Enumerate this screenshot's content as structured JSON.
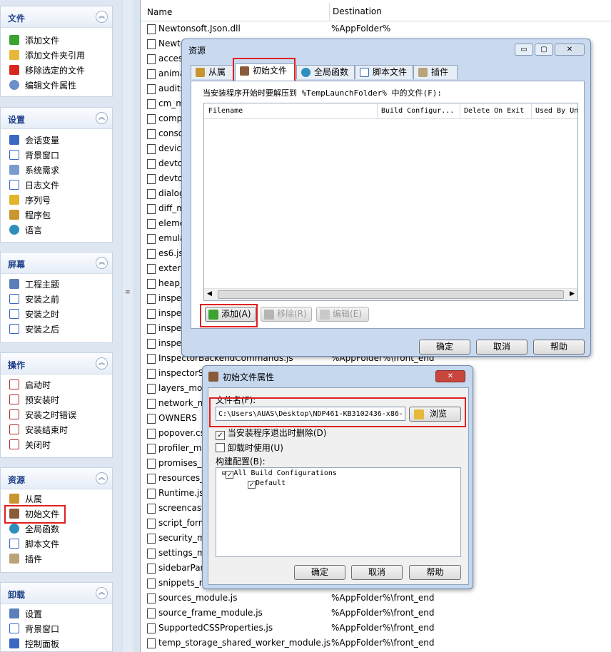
{
  "sidebar": {
    "groups": [
      {
        "title": "文件",
        "items": [
          "添加文件",
          "添加文件夹引用",
          "移除选定的文件",
          "编辑文件属性"
        ]
      },
      {
        "title": "设置",
        "items": [
          "会话变量",
          "背景窗口",
          "系统需求",
          "日志文件",
          "序列号",
          "程序包",
          "语言"
        ]
      },
      {
        "title": "屏幕",
        "items": [
          "工程主题",
          "安装之前",
          "安装之时",
          "安装之后"
        ]
      },
      {
        "title": "操作",
        "items": [
          "启动时",
          "预安装时",
          "安装之时错误",
          "安装结束时",
          "关闭时"
        ]
      },
      {
        "title": "资源",
        "items": [
          "从属",
          "初始文件",
          "全局函数",
          "脚本文件",
          "插件"
        ]
      },
      {
        "title": "卸载",
        "items": [
          "设置",
          "背景窗口",
          "控制面板"
        ]
      }
    ],
    "collapse_icon": "︽"
  },
  "file_list": {
    "columns": [
      "Name",
      "Destination"
    ],
    "rows": [
      {
        "name": "Newtonsoft.Json.dll",
        "dest": "%AppFolder%"
      },
      {
        "name": "Newtonsoft.Json.xml",
        "dest": ""
      },
      {
        "name": "accessibility_module.js",
        "dest": ""
      },
      {
        "name": "animation_module.js",
        "dest": ""
      },
      {
        "name": "audits_module.js",
        "dest": ""
      },
      {
        "name": "cm_modes_module.js",
        "dest": ""
      },
      {
        "name": "components_module.js",
        "dest": ""
      },
      {
        "name": "console_module.js",
        "dest": ""
      },
      {
        "name": "devices_module.js",
        "dest": ""
      },
      {
        "name": "devtools_app.js",
        "dest": ""
      },
      {
        "name": "devtools_app.html",
        "dest": ""
      },
      {
        "name": "dialog.css",
        "dest": ""
      },
      {
        "name": "diff_module.js",
        "dest": ""
      },
      {
        "name": "elements_module.js",
        "dest": ""
      },
      {
        "name": "emulation_module.js",
        "dest": ""
      },
      {
        "name": "es6.js",
        "dest": ""
      },
      {
        "name": "externs.js",
        "dest": ""
      },
      {
        "name": "heap_snapshot_worker.js",
        "dest": ""
      },
      {
        "name": "inspector.css",
        "dest": ""
      },
      {
        "name": "inspector.html",
        "dest": ""
      },
      {
        "name": "inspector.js",
        "dest": ""
      },
      {
        "name": "inspector.json",
        "dest": ""
      },
      {
        "name": "InspectorBackendCommands.js",
        "dest": "%AppFolder%\\front_end"
      },
      {
        "name": "inspectorStyle.css",
        "dest": ""
      },
      {
        "name": "layers_module.js",
        "dest": ""
      },
      {
        "name": "network_module.js",
        "dest": ""
      },
      {
        "name": "OWNERS",
        "dest": ""
      },
      {
        "name": "popover.css",
        "dest": ""
      },
      {
        "name": "profiler_module.js",
        "dest": ""
      },
      {
        "name": "promises_module.js",
        "dest": ""
      },
      {
        "name": "resources_module.js",
        "dest": ""
      },
      {
        "name": "Runtime.js",
        "dest": ""
      },
      {
        "name": "screencast_module.js",
        "dest": ""
      },
      {
        "name": "script_formatter_worker.js",
        "dest": ""
      },
      {
        "name": "security_module.js",
        "dest": ""
      },
      {
        "name": "settings_module.js",
        "dest": ""
      },
      {
        "name": "sidebarPane.css",
        "dest": ""
      },
      {
        "name": "snippets_module.js",
        "dest": ""
      },
      {
        "name": "sources_module.js",
        "dest": "%AppFolder%\\front_end"
      },
      {
        "name": "source_frame_module.js",
        "dest": "%AppFolder%\\front_end"
      },
      {
        "name": "SupportedCSSProperties.js",
        "dest": "%AppFolder%\\front_end"
      },
      {
        "name": "temp_storage_shared_worker_module.js",
        "dest": "%AppFolder%\\front_end"
      }
    ]
  },
  "resources_dialog": {
    "title": "资源",
    "title_buttons": [
      "▭",
      "▢",
      "✕"
    ],
    "tabs": [
      "从属",
      "初始文件",
      "全局函数",
      "脚本文件",
      "插件"
    ],
    "description": "当安装程序开始时要解压到 %TempLaunchFolder% 中的文件(F):",
    "columns": [
      "Filename",
      "Build Configur...",
      "Delete On Exit",
      "Used By Un"
    ],
    "buttons": {
      "add": "添加(A)",
      "remove": "移除(R)",
      "edit": "编辑(E)"
    },
    "footer": {
      "ok": "确定",
      "cancel": "取消",
      "help": "帮助"
    }
  },
  "props_dialog": {
    "title": "初始文件属性",
    "filename_label": "文件名(F):",
    "filename_value": "C:\\Users\\AUAS\\Desktop\\NDP461-KB3102436-x86-",
    "browse": "浏览",
    "delete_on_exit": "当安装程序退出时删除(D)",
    "used_on_uninstall": "卸载时使用(U)",
    "build_config_label": "构建配置(B):",
    "tree": [
      "All Build Configurations",
      "Default"
    ],
    "footer": {
      "ok": "确定",
      "cancel": "取消",
      "help": "帮助"
    }
  },
  "colors": {
    "highlight": "#e02020",
    "group_title": "#1d3f8a"
  }
}
